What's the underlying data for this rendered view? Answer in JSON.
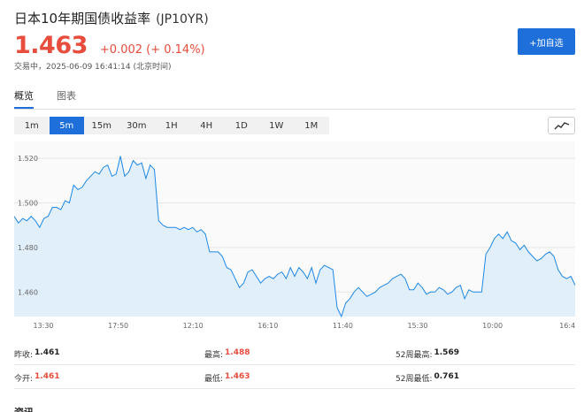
{
  "header": {
    "title": "日本10年期国债收益率",
    "ticker": "(JP10YR)",
    "add_watchlist_label": "+加自选"
  },
  "quote": {
    "price": "1.463",
    "change": "+0.002 (+ 0.14%)",
    "status": "交易中，2025-06-09 16:41:14 (北京时间)"
  },
  "tabs": [
    {
      "label": "概览",
      "active": true
    },
    {
      "label": "图表",
      "active": false
    }
  ],
  "intervals": [
    {
      "label": "1m",
      "active": false
    },
    {
      "label": "5m",
      "active": true
    },
    {
      "label": "15m",
      "active": false
    },
    {
      "label": "30m",
      "active": false
    },
    {
      "label": "1H",
      "active": false
    },
    {
      "label": "4H",
      "active": false
    },
    {
      "label": "1D",
      "active": false
    },
    {
      "label": "1W",
      "active": false
    },
    {
      "label": "1M",
      "active": false
    }
  ],
  "chart_type_icon": "line-chart-icon",
  "chart_data": {
    "type": "area",
    "x_tick_labels": [
      "13:30",
      "17:50",
      "12:10",
      "16:10",
      "11:40",
      "15:30",
      "10:00",
      "16:4"
    ],
    "y_ticks": [
      1.46,
      1.48,
      1.5,
      1.52
    ],
    "y_tick_labels": [
      "1.460",
      "1.480",
      "1.500",
      "1.520"
    ],
    "ylim": [
      1.449,
      1.526
    ],
    "line_color": "#1e88e5",
    "fill_color": "#e1effb",
    "values": [
      1.494,
      1.491,
      1.493,
      1.492,
      1.494,
      1.492,
      1.489,
      1.493,
      1.494,
      1.498,
      1.498,
      1.497,
      1.501,
      1.5,
      1.508,
      1.506,
      1.507,
      1.51,
      1.512,
      1.514,
      1.513,
      1.516,
      1.517,
      1.512,
      1.513,
      1.521,
      1.512,
      1.514,
      1.519,
      1.517,
      1.518,
      1.511,
      1.517,
      1.515,
      1.492,
      1.49,
      1.489,
      1.489,
      1.489,
      1.488,
      1.489,
      1.488,
      1.489,
      1.487,
      1.488,
      1.486,
      1.478,
      1.478,
      1.478,
      1.476,
      1.471,
      1.47,
      1.466,
      1.462,
      1.464,
      1.469,
      1.47,
      1.467,
      1.464,
      1.466,
      1.467,
      1.466,
      1.468,
      1.469,
      1.466,
      1.471,
      1.467,
      1.471,
      1.469,
      1.466,
      1.471,
      1.464,
      1.47,
      1.472,
      1.471,
      1.47,
      1.453,
      1.449,
      1.455,
      1.457,
      1.46,
      1.462,
      1.46,
      1.458,
      1.459,
      1.46,
      1.462,
      1.463,
      1.464,
      1.466,
      1.467,
      1.468,
      1.466,
      1.461,
      1.461,
      1.464,
      1.462,
      1.459,
      1.46,
      1.46,
      1.462,
      1.461,
      1.459,
      1.46,
      1.462,
      1.463,
      1.457,
      1.461,
      1.46,
      1.46,
      1.46,
      1.477,
      1.48,
      1.484,
      1.486,
      1.484,
      1.487,
      1.483,
      1.482,
      1.479,
      1.481,
      1.478,
      1.476,
      1.474,
      1.475,
      1.477,
      1.478,
      1.476,
      1.47,
      1.467,
      1.466,
      1.467,
      1.463
    ]
  },
  "stats": {
    "prev_close": {
      "label": "昨收:",
      "value": "1.461"
    },
    "high": {
      "label": "最高:",
      "value": "1.488"
    },
    "high_52w": {
      "label": "52周最高:",
      "value": "1.569"
    },
    "open": {
      "label": "今开:",
      "value": "1.461"
    },
    "low": {
      "label": "最低:",
      "value": "1.463"
    },
    "low_52w": {
      "label": "52周最低:",
      "value": "0.761"
    }
  },
  "news_heading": "资讯",
  "colors": {
    "accent": "#1e6fd9",
    "up": "#e74c3c"
  }
}
